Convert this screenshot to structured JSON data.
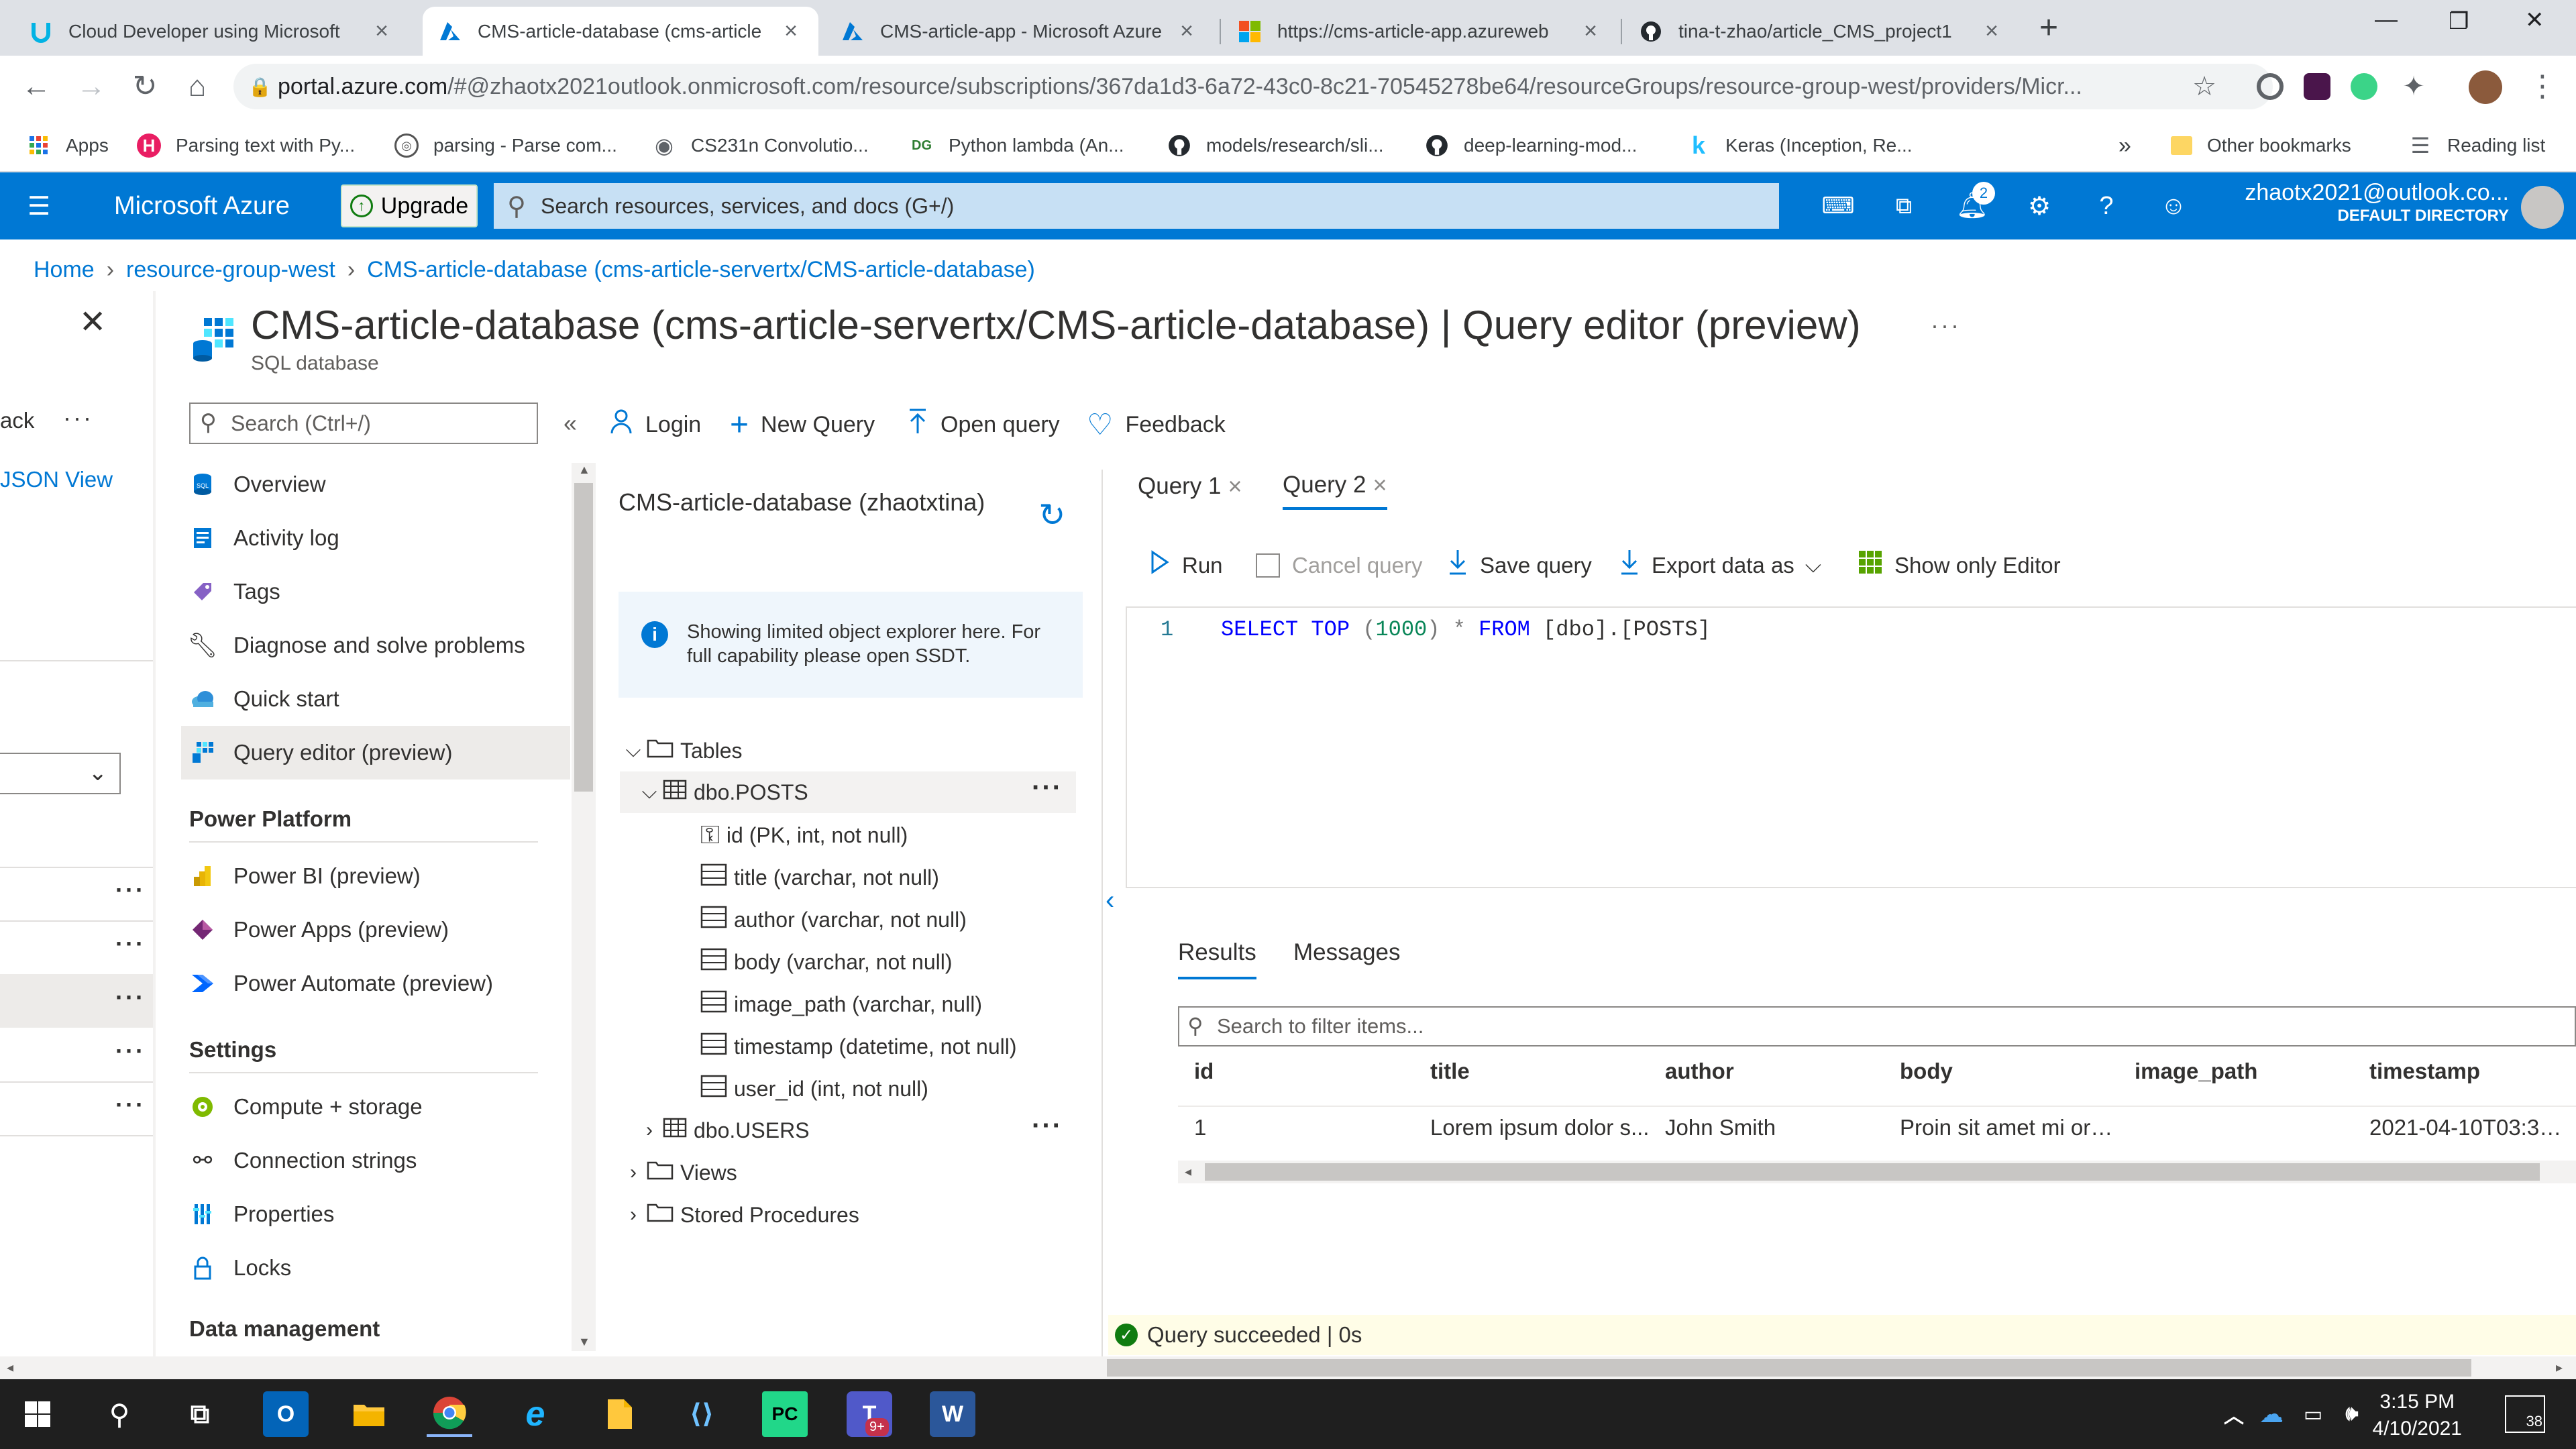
{
  "browser": {
    "tabs": [
      {
        "title": "Cloud Developer using Microsoft",
        "icon": "udacity-icon",
        "active": false
      },
      {
        "title": "CMS-article-database (cms-article",
        "icon": "azure-icon",
        "active": true
      },
      {
        "title": "CMS-article-app - Microsoft Azure",
        "icon": "azure-icon",
        "active": false
      },
      {
        "title": "https://cms-article-app.azureweb",
        "icon": "microsoft-icon",
        "active": false
      },
      {
        "title": "tina-t-zhao/article_CMS_project1",
        "icon": "github-icon",
        "active": false
      }
    ],
    "new_tab": "+",
    "address": {
      "host": "portal.azure.com",
      "rest": "/#@zhaotx2021outlook.onmicrosoft.com/resource/subscriptions/367da1d3-6a72-43c0-8c21-70545278be64/resourceGroups/resource-group-west/providers/Micr..."
    },
    "bookmarks": [
      {
        "label": "Apps",
        "icon": "apps-grid-icon"
      },
      {
        "label": "Parsing text with Py...",
        "icon": "hackernoon-icon"
      },
      {
        "label": "parsing - Parse com...",
        "icon": "stackexchange-icon"
      },
      {
        "label": "CS231n Convolutio...",
        "icon": "globe-icon"
      },
      {
        "label": "Python lambda (An...",
        "icon": "dg-icon",
        "prefix": "DG"
      },
      {
        "label": "models/research/sli...",
        "icon": "github-icon"
      },
      {
        "label": "deep-learning-mod...",
        "icon": "github-icon"
      },
      {
        "label": "Keras (Inception, Re...",
        "icon": "kaggle-icon",
        "prefix": "k"
      }
    ],
    "bookmarks_more": "»",
    "other_bookmarks": "Other bookmarks",
    "reading_list": "Reading list"
  },
  "azure": {
    "brand": "Microsoft Azure",
    "upgrade": "Upgrade",
    "search_placeholder": "Search resources, services, and docs (G+/)",
    "notifications_count": "2",
    "user_email": "zhaotx2021@outlook.co...",
    "directory": "DEFAULT DIRECTORY"
  },
  "breadcrumb": [
    "Home",
    "resource-group-west",
    "CMS-article-database (cms-article-servertx/CMS-article-database)"
  ],
  "left_strip": {
    "partial_label": "ack",
    "json_view": "JSON View"
  },
  "page": {
    "title": "CMS-article-database (cms-article-servertx/CMS-article-database) | Query editor (preview)",
    "subtitle": "SQL database",
    "more": "···"
  },
  "sidebar": {
    "search_placeholder": "Search (Ctrl+/)",
    "collapse": "«",
    "items": [
      {
        "label": "Overview",
        "icon": "sql-icon"
      },
      {
        "label": "Activity log",
        "icon": "activity-log-icon"
      },
      {
        "label": "Tags",
        "icon": "tag-icon"
      },
      {
        "label": "Diagnose and solve problems",
        "icon": "wrench-icon"
      },
      {
        "label": "Quick start",
        "icon": "cloud-icon"
      },
      {
        "label": "Query editor (preview)",
        "icon": "grid-icon",
        "selected": true
      }
    ],
    "section_power": "Power Platform",
    "power_items": [
      {
        "label": "Power BI (preview)",
        "icon": "powerbi-icon"
      },
      {
        "label": "Power Apps (preview)",
        "icon": "powerapps-icon"
      },
      {
        "label": "Power Automate (preview)",
        "icon": "powerautomate-icon"
      }
    ],
    "section_settings": "Settings",
    "settings_items": [
      {
        "label": "Compute + storage",
        "icon": "compute-icon"
      },
      {
        "label": "Connection strings",
        "icon": "plug-icon"
      },
      {
        "label": "Properties",
        "icon": "properties-icon"
      },
      {
        "label": "Locks",
        "icon": "lock-icon"
      }
    ],
    "section_data": "Data management"
  },
  "toolbar": {
    "login": "Login",
    "new_query": "New Query",
    "open_query": "Open query",
    "feedback": "Feedback"
  },
  "explorer": {
    "title": "CMS-article-database (zhaotxtina)",
    "info": "Showing limited object explorer here. For full capability please open SSDT.",
    "tables": "Tables",
    "posts_table": "dbo.POSTS",
    "columns": [
      {
        "label": "id (PK, int, not null)",
        "icon": "key-icon"
      },
      {
        "label": "title (varchar, not null)",
        "icon": "column-icon"
      },
      {
        "label": "author (varchar, not null)",
        "icon": "column-icon"
      },
      {
        "label": "body (varchar, not null)",
        "icon": "column-icon"
      },
      {
        "label": "image_path (varchar, null)",
        "icon": "column-icon"
      },
      {
        "label": "timestamp (datetime, not null)",
        "icon": "column-icon"
      },
      {
        "label": "user_id (int, not null)",
        "icon": "column-icon"
      }
    ],
    "users_table": "dbo.USERS",
    "views": "Views",
    "procedures": "Stored Procedures"
  },
  "editor": {
    "tabs": [
      {
        "label": "Query 1",
        "active": false
      },
      {
        "label": "Query 2",
        "active": true
      }
    ],
    "run": "Run",
    "cancel": "Cancel query",
    "save": "Save query",
    "export": "Export data as",
    "show_only": "Show only Editor",
    "line_no": "1",
    "code": {
      "k1": "SELECT",
      "k2": "TOP",
      "p1": "(",
      "num": "1000",
      "p2": ")",
      "star": "*",
      "k3": "FROM",
      "tbl": "[dbo].[POSTS]"
    }
  },
  "results": {
    "tabs": [
      "Results",
      "Messages"
    ],
    "filter_placeholder": "Search to filter items...",
    "columns": [
      "id",
      "title",
      "author",
      "body",
      "image_path",
      "timestamp"
    ],
    "rows": [
      [
        "1",
        "Lorem ipsum dolor s...",
        "John Smith",
        "Proin sit amet mi orn...",
        "",
        "2021-04-10T03:34:2..."
      ]
    ]
  },
  "status": "Query succeeded | 0s",
  "taskbar": {
    "time": "3:15 PM",
    "date": "4/10/2021",
    "notifications": "38",
    "teams_badge": "9+"
  },
  "colors": {
    "azure_blue": "#0078d4",
    "success": "#107c10",
    "tab_bar": "#dee1e6"
  }
}
